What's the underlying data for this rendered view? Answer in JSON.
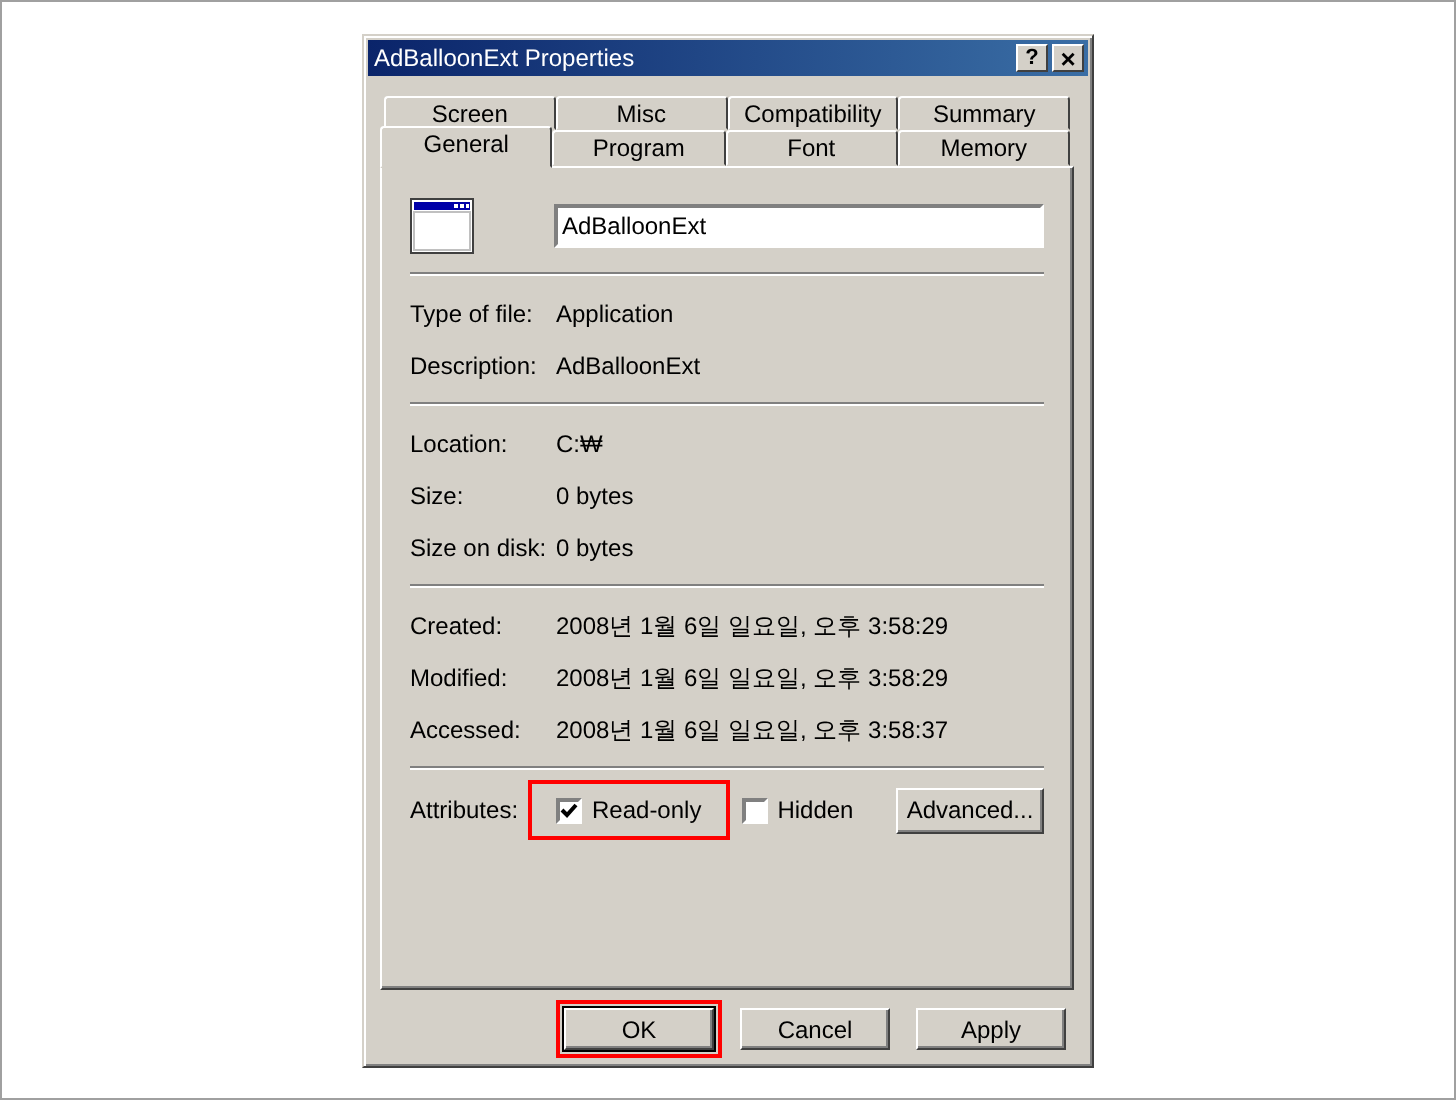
{
  "window": {
    "title": "AdBalloonExt Properties",
    "help_button": "?",
    "close_button": "×"
  },
  "tab_rows": [
    [
      {
        "label": "Screen",
        "selected": false
      },
      {
        "label": "Misc",
        "selected": false
      },
      {
        "label": "Compatibility",
        "selected": false
      },
      {
        "label": "Summary",
        "selected": false
      }
    ],
    [
      {
        "label": "General",
        "selected": true
      },
      {
        "label": "Program",
        "selected": false
      },
      {
        "label": "Font",
        "selected": false
      },
      {
        "label": "Memory",
        "selected": false
      }
    ]
  ],
  "name_field": {
    "value": "AdBalloonExt"
  },
  "sections": [
    [
      {
        "label": "Type of file:",
        "value": "Application"
      },
      {
        "label": "Description:",
        "value": "AdBalloonExt"
      }
    ],
    [
      {
        "label": "Location:",
        "value": "C:₩"
      },
      {
        "label": "Size:",
        "value": "0 bytes"
      },
      {
        "label": "Size on disk:",
        "value": "0 bytes"
      }
    ],
    [
      {
        "label": "Created:",
        "value": "2008년 1월 6일 일요일, 오후 3:58:29"
      },
      {
        "label": "Modified:",
        "value": "2008년 1월 6일 일요일, 오후 3:58:29"
      },
      {
        "label": "Accessed:",
        "value": "2008년 1월 6일 일요일, 오후 3:58:37"
      }
    ]
  ],
  "attributes": {
    "label": "Attributes:",
    "checkboxes": [
      {
        "label": "Read-only",
        "checked": true,
        "highlighted": true
      },
      {
        "label": "Hidden",
        "checked": false,
        "highlighted": false
      }
    ],
    "advanced_button": "Advanced..."
  },
  "buttons": [
    {
      "label": "OK",
      "default": true,
      "highlighted": true
    },
    {
      "label": "Cancel",
      "default": false,
      "highlighted": false
    },
    {
      "label": "Apply",
      "default": false,
      "highlighted": false
    }
  ]
}
